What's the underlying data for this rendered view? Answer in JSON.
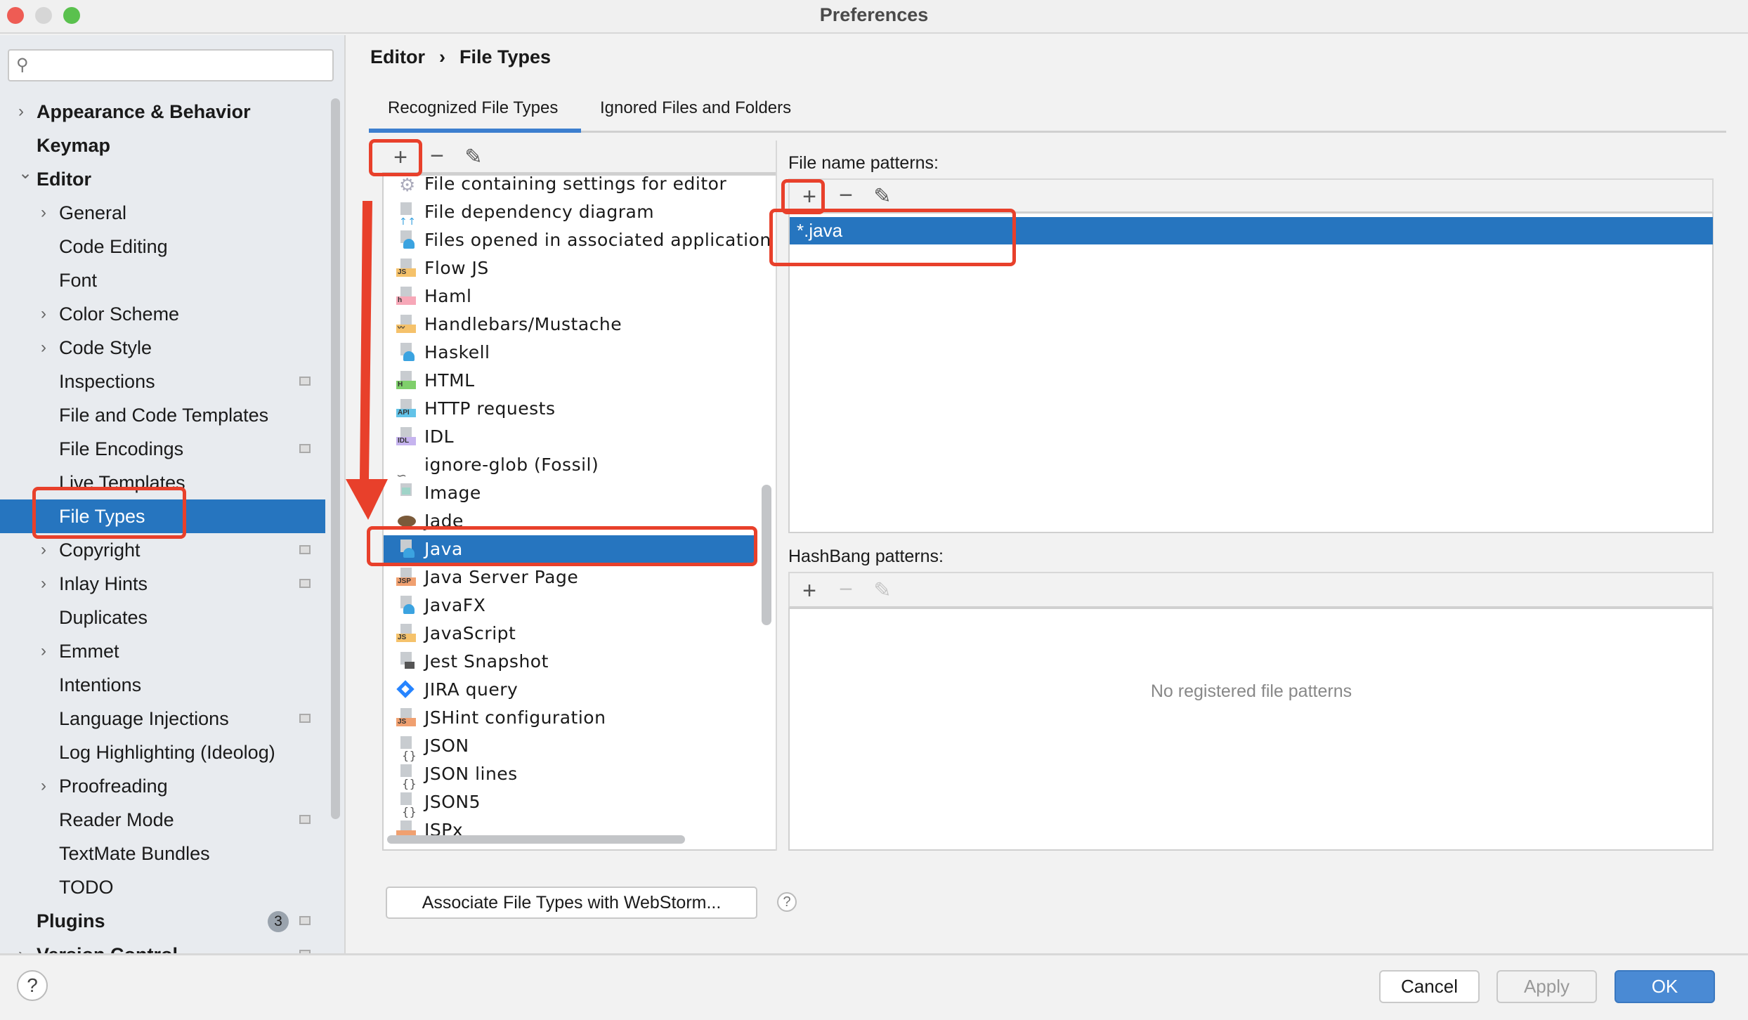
{
  "window": {
    "title": "Preferences"
  },
  "sidebar": {
    "search_placeholder": "",
    "items": [
      {
        "label": "Appearance & Behavior",
        "level": 0,
        "bold": true,
        "chevron": "right"
      },
      {
        "label": "Keymap",
        "level": 0,
        "bold": true
      },
      {
        "label": "Editor",
        "level": 0,
        "bold": true,
        "chevron": "down"
      },
      {
        "label": "General",
        "level": 1,
        "chevron": "right"
      },
      {
        "label": "Code Editing",
        "level": 1
      },
      {
        "label": "Font",
        "level": 1
      },
      {
        "label": "Color Scheme",
        "level": 1,
        "chevron": "right"
      },
      {
        "label": "Code Style",
        "level": 1,
        "chevron": "right"
      },
      {
        "label": "Inspections",
        "level": 1,
        "project_icon": true
      },
      {
        "label": "File and Code Templates",
        "level": 1
      },
      {
        "label": "File Encodings",
        "level": 1,
        "project_icon": true
      },
      {
        "label": "Live Templates",
        "level": 1
      },
      {
        "label": "File Types",
        "level": 1,
        "selected": true
      },
      {
        "label": "Copyright",
        "level": 1,
        "chevron": "right",
        "project_icon": true
      },
      {
        "label": "Inlay Hints",
        "level": 1,
        "chevron": "right",
        "project_icon": true
      },
      {
        "label": "Duplicates",
        "level": 1
      },
      {
        "label": "Emmet",
        "level": 1,
        "chevron": "right"
      },
      {
        "label": "Intentions",
        "level": 1
      },
      {
        "label": "Language Injections",
        "level": 1,
        "project_icon": true
      },
      {
        "label": "Log Highlighting (Ideolog)",
        "level": 1
      },
      {
        "label": "Proofreading",
        "level": 1,
        "chevron": "right"
      },
      {
        "label": "Reader Mode",
        "level": 1,
        "project_icon": true
      },
      {
        "label": "TextMate Bundles",
        "level": 1
      },
      {
        "label": "TODO",
        "level": 1
      },
      {
        "label": "Plugins",
        "level": 0,
        "bold": true,
        "badge": "3",
        "project_icon": true
      },
      {
        "label": "Version Control",
        "level": 0,
        "bold": true,
        "chevron": "right",
        "project_icon": true
      }
    ]
  },
  "breadcrumb": [
    "Editor",
    "File Types"
  ],
  "breadcrumb_separator": "›",
  "tabs": [
    {
      "label": "Recognized File Types",
      "active": true
    },
    {
      "label": "Ignored Files and Folders"
    }
  ],
  "file_types": [
    {
      "label": "File containing settings for editor",
      "icon": "gear"
    },
    {
      "label": "File dependency diagram",
      "icon": "diagram"
    },
    {
      "label": "Files opened in associated application",
      "icon": "user"
    },
    {
      "label": "Flow JS",
      "icon": "tag",
      "tag": "JS",
      "color": "#f5c26b"
    },
    {
      "label": "Haml",
      "icon": "tag",
      "tag": "h",
      "color": "#f7a8b8"
    },
    {
      "label": "Handlebars/Mustache",
      "icon": "tag",
      "tag": "〰",
      "color": "#f5c26b"
    },
    {
      "label": "Haskell",
      "icon": "user"
    },
    {
      "label": "HTML",
      "icon": "tag",
      "tag": "H",
      "color": "#7fcf6b"
    },
    {
      "label": "HTTP requests",
      "icon": "tag",
      "tag": "API",
      "color": "#63c3e8"
    },
    {
      "label": "IDL",
      "icon": "tag",
      "tag": "IDL",
      "color": "#c6b4ef"
    },
    {
      "label": "ignore-glob (Fossil)",
      "icon": "fossil"
    },
    {
      "label": "Image",
      "icon": "image"
    },
    {
      "label": "Jade",
      "icon": "pug"
    },
    {
      "label": "Java",
      "icon": "user",
      "selected": true
    },
    {
      "label": "Java Server Page",
      "icon": "tag",
      "tag": "JSP",
      "color": "#f0a070"
    },
    {
      "label": "JavaFX",
      "icon": "user"
    },
    {
      "label": "JavaScript",
      "icon": "tag",
      "tag": "JS",
      "color": "#f5c26b"
    },
    {
      "label": "Jest Snapshot",
      "icon": "camera"
    },
    {
      "label": "JIRA query",
      "icon": "jira"
    },
    {
      "label": "JSHint configuration",
      "icon": "tag",
      "tag": "JS",
      "color": "#f0a070"
    },
    {
      "label": "JSON",
      "icon": "braces"
    },
    {
      "label": "JSON lines",
      "icon": "braces"
    },
    {
      "label": "JSON5",
      "icon": "braces"
    },
    {
      "label": "JSPx",
      "icon": "tag",
      "tag": "",
      "color": "#f0a070"
    }
  ],
  "file_name_patterns": {
    "label": "File name patterns:",
    "items": [
      "*.java"
    ]
  },
  "hashbang_patterns": {
    "label": "HashBang patterns:",
    "empty_text": "No registered file patterns"
  },
  "toolbar": {
    "add": "+",
    "remove": "−",
    "edit": "✎"
  },
  "associate_button": "Associate File Types with WebStorm...",
  "help": "?",
  "buttons": {
    "cancel": "Cancel",
    "apply": "Apply",
    "ok": "OK"
  },
  "colors": {
    "selection": "#2675bf",
    "annotation": "#e8402b",
    "ok_button": "#4a8ad4"
  }
}
